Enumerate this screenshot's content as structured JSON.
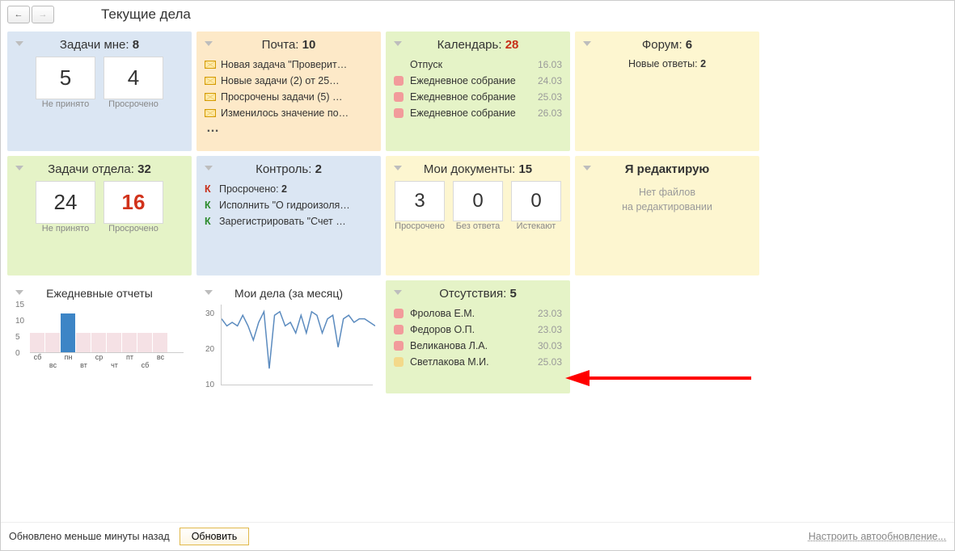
{
  "page_title": "Текущие дела",
  "tasks_me": {
    "title": "Задачи мне:",
    "count": "8",
    "val1": "5",
    "cap1": "Не принято",
    "val2": "4",
    "cap2": "Просрочено"
  },
  "mail": {
    "title": "Почта:",
    "count": "10",
    "items": [
      "Новая задача \"Проверит…",
      "Новые задачи (2) от 25…",
      "Просрочены задачи (5) …",
      "Изменилось значение по…"
    ],
    "more": "…"
  },
  "calendar": {
    "title": "Календарь:",
    "count": "28",
    "items": [
      {
        "txt": "Отпуск",
        "date": "16.03",
        "marker": false
      },
      {
        "txt": "Ежедневное собрание",
        "date": "24.03",
        "marker": true
      },
      {
        "txt": "Ежедневное собрание",
        "date": "25.03",
        "marker": true
      },
      {
        "txt": "Ежедневное собрание",
        "date": "26.03",
        "marker": true
      }
    ]
  },
  "forum": {
    "title": "Форум:",
    "count": "6",
    "line_label": "Новые ответы:",
    "line_val": "2"
  },
  "tasks_dept": {
    "title": "Задачи отдела:",
    "count": "32",
    "val1": "24",
    "cap1": "Не принято",
    "val2": "16",
    "cap2": "Просрочено"
  },
  "control": {
    "title": "Контроль:",
    "count": "2",
    "items": [
      {
        "k": "К",
        "kred": true,
        "txt": "Просрочено:",
        "bold": "2"
      },
      {
        "k": "К",
        "kred": false,
        "txt": "Исполнить \"О гидроизоля…"
      },
      {
        "k": "К",
        "kred": false,
        "txt": "Зарегистрировать \"Счет …"
      }
    ]
  },
  "mydocs": {
    "title": "Мои документы:",
    "count": "15",
    "v1": "3",
    "c1": "Просрочено",
    "v2": "0",
    "c2": "Без ответа",
    "v3": "0",
    "c3": "Истекают"
  },
  "editing": {
    "title": "Я редактирую",
    "hint1": "Нет файлов",
    "hint2": "на редактировании"
  },
  "daily": {
    "title": "Ежедневные отчеты"
  },
  "mycases": {
    "title": "Мои дела (за месяц)"
  },
  "absences": {
    "title": "Отсутствия:",
    "count": "5",
    "items": [
      {
        "txt": "Фролова Е.М.",
        "date": "23.03",
        "c": "pink"
      },
      {
        "txt": "Федоров О.П.",
        "date": "23.03",
        "c": "pink"
      },
      {
        "txt": "Великанова Л.А.",
        "date": "30.03",
        "c": "pink"
      },
      {
        "txt": "Светлакова М.И.",
        "date": "25.03",
        "c": "yel"
      }
    ]
  },
  "footer": {
    "status": "Обновлено меньше минуты назад",
    "refresh": "Обновить",
    "config": "Настроить автообновление..."
  },
  "chart_data": [
    {
      "type": "bar",
      "title": "Ежедневные отчеты",
      "categories": [
        "сб",
        "вс",
        "пн",
        "вт",
        "ср",
        "чт",
        "пт",
        "сб",
        "вс"
      ],
      "values": [
        6,
        6,
        12,
        6,
        6,
        6,
        6,
        6,
        6
      ],
      "highlight_index": 2,
      "ylim": [
        0,
        15
      ],
      "yticks": [
        0,
        5,
        10,
        15
      ]
    },
    {
      "type": "line",
      "title": "Мои дела (за месяц)",
      "x": [
        1,
        2,
        3,
        4,
        5,
        6,
        7,
        8,
        9,
        10,
        11,
        12,
        13,
        14,
        15,
        16,
        17,
        18,
        19,
        20,
        21,
        22,
        23,
        24,
        25,
        26,
        27,
        28,
        29,
        30
      ],
      "values": [
        26,
        24,
        25,
        24,
        27,
        24,
        20,
        25,
        28,
        12,
        27,
        28,
        24,
        25,
        22,
        27,
        22,
        28,
        27,
        22,
        26,
        27,
        18,
        26,
        27,
        25,
        26,
        26,
        25,
        24
      ],
      "ylim": [
        10,
        30
      ],
      "yticks": [
        10,
        20,
        30
      ]
    }
  ]
}
